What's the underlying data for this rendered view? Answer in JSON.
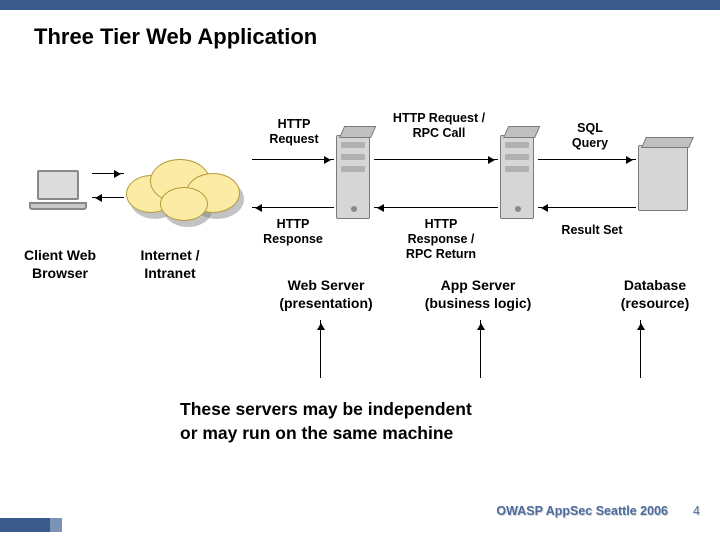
{
  "title": "Three Tier Web Application",
  "nodes": {
    "client": "Client Web\nBrowser",
    "internet": "Internet /\nIntranet",
    "web": "Web Server\n(presentation)",
    "app": "App Server\n(business logic)",
    "db": "Database\n(resource)"
  },
  "arrows": {
    "http_request": "HTTP\nRequest",
    "http_response": "HTTP\nResponse",
    "rpc_call": "HTTP Request /\nRPC Call",
    "rpc_return": "HTTP\nResponse /\nRPC Return",
    "sql_query": "SQL\nQuery",
    "result_set": "Result Set"
  },
  "caption": "These servers may be independent\n  or may run on the same machine",
  "footer": {
    "event": "OWASP AppSec Seattle 2006",
    "page": "4"
  }
}
